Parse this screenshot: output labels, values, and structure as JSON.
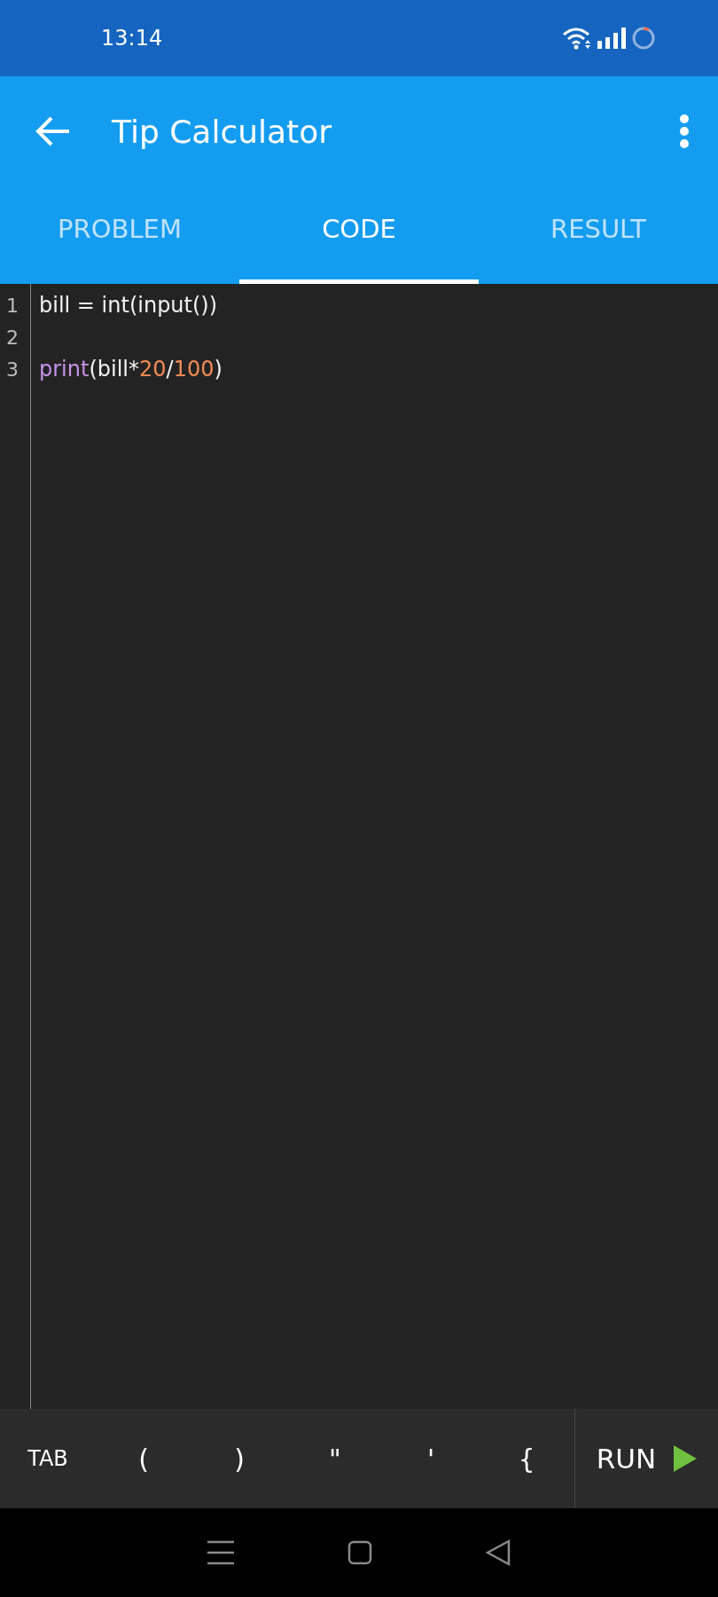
{
  "status_bar": {
    "time": "13:14"
  },
  "app_bar": {
    "title": "Tip Calculator"
  },
  "tabs": [
    {
      "label": "PROBLEM",
      "selected": false
    },
    {
      "label": "CODE",
      "selected": true
    },
    {
      "label": "RESULT",
      "selected": false
    }
  ],
  "editor": {
    "lines": [
      {
        "number": "1",
        "tokens": [
          {
            "text": "bill = int(input())",
            "kind": "plain"
          }
        ]
      },
      {
        "number": "2"
      },
      {
        "number": "3",
        "tokens": [
          {
            "text": "print",
            "kind": "keyword"
          },
          {
            "text": "(bill*",
            "kind": "plain"
          },
          {
            "text": "20",
            "kind": "number"
          },
          {
            "text": "/",
            "kind": "plain"
          },
          {
            "text": "100",
            "kind": "number"
          },
          {
            "text": ")",
            "kind": "plain"
          }
        ]
      }
    ]
  },
  "keys": [
    "TAB",
    "(",
    ")",
    "\"",
    "'",
    "{"
  ],
  "run_button": {
    "label": "RUN"
  }
}
